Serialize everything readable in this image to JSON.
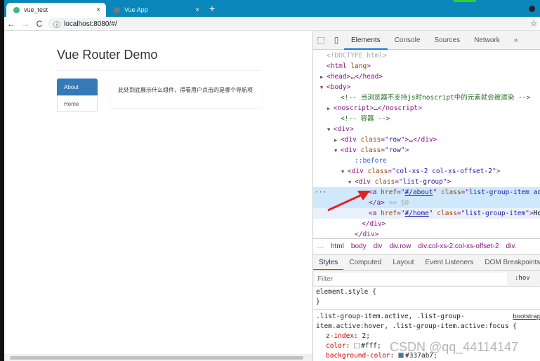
{
  "browser": {
    "tabs": [
      {
        "title": "vue_test",
        "active": true,
        "favicon_color": "#42b883"
      },
      {
        "title": "Vue App",
        "active": false,
        "favicon_color": "#777"
      }
    ],
    "url": "localhost:8080/#/",
    "new_tab": "+",
    "close": "×",
    "back": "←",
    "forward": "→",
    "reload": "C",
    "info": "ⓘ",
    "star": "☆"
  },
  "page": {
    "title": "Vue Router Demo",
    "nav": [
      {
        "label": "About",
        "active": true
      },
      {
        "label": "Home",
        "active": false
      }
    ],
    "panel_text": "此处到底展示什么组件，得看用户点击的是哪个导航项"
  },
  "devtools": {
    "tabs": [
      "Elements",
      "Console",
      "Sources",
      "Network"
    ],
    "more": "»",
    "active_tab": "Elements",
    "tree": [
      {
        "i": 0,
        "a": "",
        "s": [
          [
            "dg",
            "<!DOCTYPE html>"
          ]
        ]
      },
      {
        "i": 0,
        "a": "",
        "s": [
          [
            "tg",
            "<html "
          ],
          [
            "an",
            "lang"
          ],
          [
            "tg",
            ">"
          ]
        ]
      },
      {
        "i": 0,
        "a": "▶",
        "s": [
          [
            "tg",
            "<head>"
          ],
          [
            "",
            "…"
          ],
          [
            "tg",
            "</head>"
          ]
        ]
      },
      {
        "i": 0,
        "a": "▼",
        "s": [
          [
            "tg",
            "<body>"
          ]
        ]
      },
      {
        "i": 2,
        "a": "",
        "s": [
          [
            "cm",
            "<!-- 当浏览器不支持js时noscript中的元素就会被渲染 -->"
          ]
        ]
      },
      {
        "i": 1,
        "a": "▶",
        "s": [
          [
            "tg",
            "<noscript>"
          ],
          [
            "",
            "…"
          ],
          [
            "tg",
            "</noscript>"
          ]
        ]
      },
      {
        "i": 2,
        "a": "",
        "s": [
          [
            "cm",
            "<!-- 容器 -->"
          ]
        ]
      },
      {
        "i": 1,
        "a": "▼",
        "s": [
          [
            "tg",
            "<div>"
          ]
        ]
      },
      {
        "i": 2,
        "a": "▶",
        "s": [
          [
            "tg",
            "<div "
          ],
          [
            "an",
            "class"
          ],
          [
            "tg",
            "=\""
          ],
          [
            "av",
            "row"
          ],
          [
            "tg",
            "\">"
          ],
          [
            "",
            "…"
          ],
          [
            "tg",
            "</div>"
          ]
        ]
      },
      {
        "i": 2,
        "a": "▼",
        "s": [
          [
            "tg",
            "<div "
          ],
          [
            "an",
            "class"
          ],
          [
            "tg",
            "=\""
          ],
          [
            "av",
            "row"
          ],
          [
            "tg",
            "\">"
          ]
        ]
      },
      {
        "i": 4,
        "a": "",
        "s": [
          [
            "ps",
            "::before"
          ]
        ]
      },
      {
        "i": 3,
        "a": "▼",
        "s": [
          [
            "tg",
            "<div "
          ],
          [
            "an",
            "class"
          ],
          [
            "tg",
            "=\""
          ],
          [
            "av",
            "col-xs-2 col-xs-offset-2"
          ],
          [
            "tg",
            "\">"
          ]
        ]
      },
      {
        "i": 4,
        "a": "▼",
        "s": [
          [
            "tg",
            "<div "
          ],
          [
            "an",
            "class"
          ],
          [
            "tg",
            "=\""
          ],
          [
            "av",
            "list-group"
          ],
          [
            "tg",
            "\">"
          ]
        ]
      },
      {
        "i": 6,
        "a": "",
        "sel": true,
        "s": [
          [
            "tg",
            "<a "
          ],
          [
            "an",
            "href"
          ],
          [
            "tg",
            "=\""
          ],
          [
            "lk",
            "#/about"
          ],
          [
            "tg",
            "\" "
          ],
          [
            "an",
            "class"
          ],
          [
            "tg",
            "=\""
          ],
          [
            "av",
            "list-group-item active"
          ],
          [
            "tg",
            "\">"
          ]
        ]
      },
      {
        "i": 6,
        "a": "",
        "sel": true,
        "s": [
          [
            "tg",
            "</a>"
          ],
          [
            "dg",
            " == $0"
          ]
        ]
      },
      {
        "i": 6,
        "a": "",
        "hov": true,
        "s": [
          [
            "tg",
            "<a "
          ],
          [
            "an",
            "href"
          ],
          [
            "tg",
            "=\""
          ],
          [
            "lk",
            "#/home"
          ],
          [
            "tg",
            "\" "
          ],
          [
            "an",
            "class"
          ],
          [
            "tg",
            "=\""
          ],
          [
            "av",
            "list-group-item"
          ],
          [
            "tg",
            "\">"
          ],
          [
            "",
            "Home"
          ]
        ]
      },
      {
        "i": 5,
        "a": "",
        "s": [
          [
            "tg",
            "</div>"
          ]
        ]
      },
      {
        "i": 4,
        "a": "",
        "s": [
          [
            "tg",
            "</div>"
          ]
        ]
      }
    ],
    "breadcrumbs": [
      "…",
      "html",
      "body",
      "div",
      "div.row",
      "div.col-xs-2.col-xs-offset-2",
      "div."
    ],
    "style_tabs": [
      "Styles",
      "Computed",
      "Layout",
      "Event Listeners",
      "DOM Breakpoints"
    ],
    "filter_placeholder": "Filter",
    "hov": ":hov",
    "element_style": "element.style {",
    "close_brace": "}",
    "rule_selector_1": ".list-group-item.active, .list-group-",
    "rule_selector_2": "item.active:hover, .list-group-item.active:focus {",
    "rule_source": "bootstrap",
    "props": [
      {
        "name": "z-index",
        "value": "2;"
      },
      {
        "name": "color",
        "value": "#fff;",
        "swatch": "#ffffff"
      },
      {
        "name": "background-color",
        "value": "#337ab7;",
        "swatch": "#337ab7"
      }
    ]
  },
  "watermark": "CSDN @qq_44114147"
}
